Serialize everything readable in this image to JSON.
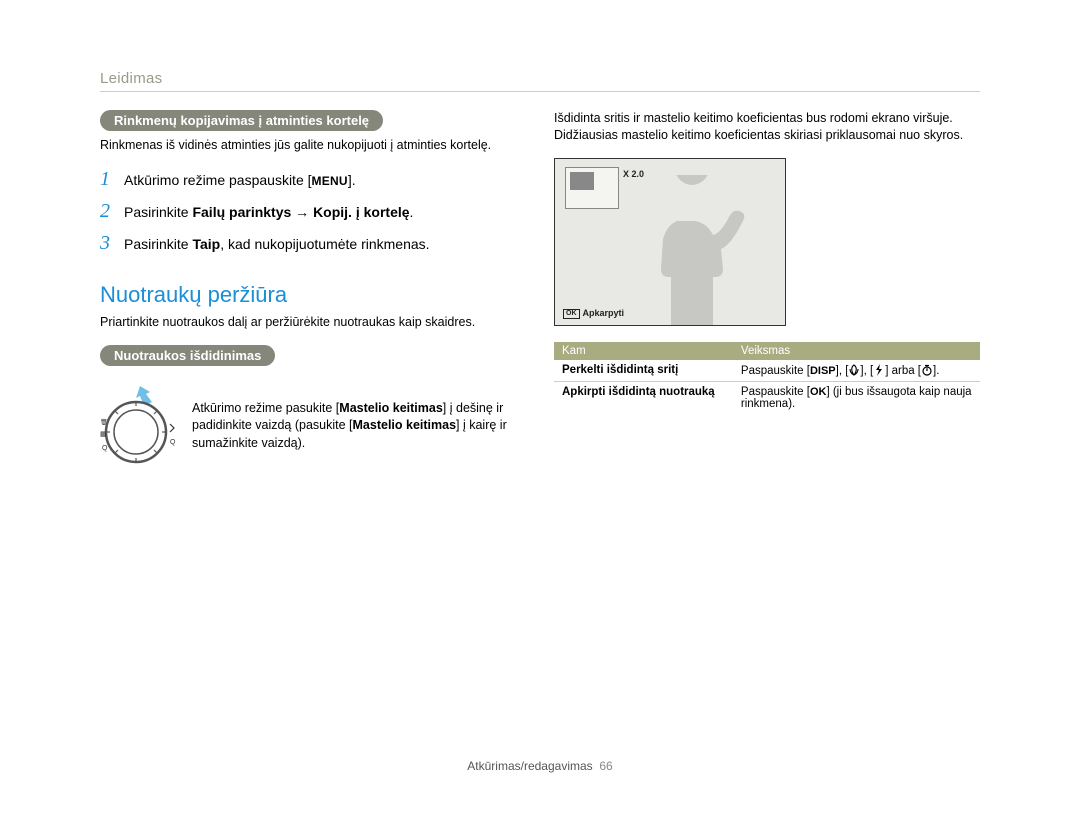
{
  "pageHeader": "Leidimas",
  "left": {
    "pill1": "Rinkmenų kopijavimas į atminties kortelę",
    "text1": "Rinkmenas iš vidinės atminties jūs galite nukopijuoti į atminties kortelę.",
    "step1_pre": "Atkūrimo režime paspauskite [",
    "step1_btn": "MENU",
    "step1_post": "].",
    "step2_pre": "Pasirinkite ",
    "step2_b1": "Failų parinktys",
    "step2_arrow": " → ",
    "step2_b2": "Kopij. į kortelę",
    "step2_post": ".",
    "step3_pre": "Pasirinkite ",
    "step3_b": "Taip",
    "step3_post": ", kad nukopijuotumėte rinkmenas.",
    "sectionTitle": "Nuotraukų peržiūra",
    "sectionLead": "Priartinkite nuotraukos dalį ar peržiūrėkite nuotraukas kaip skaidres.",
    "pill2": "Nuotraukos išdidinimas",
    "dial_pre": "Atkūrimo režime pasukite [",
    "dial_b1": "Mastelio keitimas",
    "dial_mid": "] į dešinę ir padidinkite vaizdą (pasukite [",
    "dial_b2": "Mastelio keitimas",
    "dial_post": "] į kairę ir sumažinkite vaizdą)."
  },
  "right": {
    "lead": "Išdidinta sritis ir mastelio keitimo koeficientas bus rodomi ekrano viršuje. Didžiausias mastelio keitimo koeficientas skiriasi priklausomai nuo skyros.",
    "zoomLabel": "X 2.0",
    "okLabel": "Apkarpyti",
    "thKam": "Kam",
    "thVeiksmas": "Veiksmas",
    "row1_kam": "Perkelti išdidintą sritį",
    "row1_pre": "Paspauskite [",
    "row1_k1": "DISP",
    "row1_sep": "], [",
    "row1_mid": "], [",
    "row1_or": "] arba [",
    "row1_post": "].",
    "row2_kam": "Apkirpti išdidintą nuotrauką",
    "row2_pre": "Paspauskite [",
    "row2_key": "OK",
    "row2_post": "] (ji bus išsaugota kaip nauja rinkmena)."
  },
  "footer": "Atkūrimas/redagavimas",
  "pageNum": "66"
}
